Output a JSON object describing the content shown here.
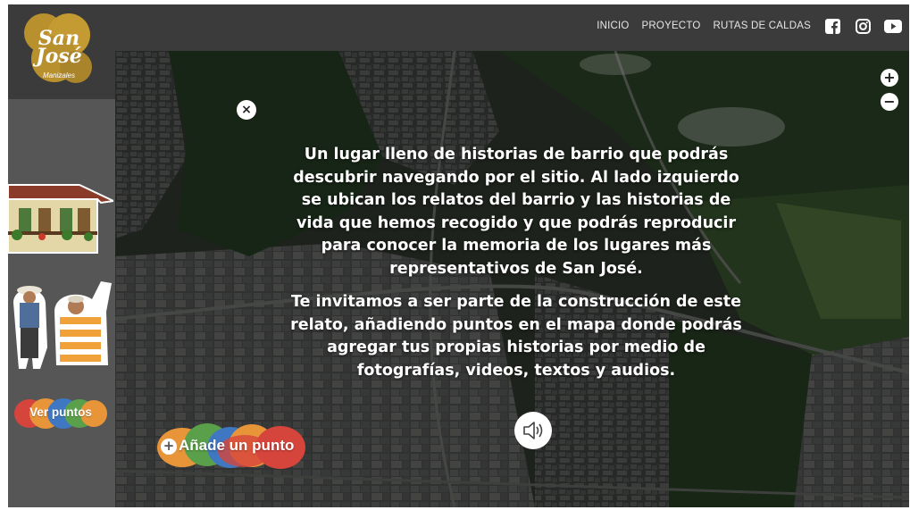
{
  "brand": {
    "title_line1": "San",
    "title_line2": "José",
    "subtitle": "Manizales",
    "color": "#b8902e"
  },
  "nav": {
    "items": [
      {
        "label": "INICIO"
      },
      {
        "label": "PROYECTO"
      },
      {
        "label": "RUTAS DE CALDAS"
      }
    ],
    "social": [
      "facebook-icon",
      "instagram-icon",
      "youtube-icon"
    ]
  },
  "sidebar": {
    "ver_puntos_label": "Ver puntos",
    "illustrations": [
      "house-illustration",
      "elders-illustration"
    ]
  },
  "intro": {
    "paragraph1": "Un lugar lleno de historias de barrio que podrás descubrir navegando por el sitio. Al lado izquierdo se ubican los relatos del barrio y las historias de vida que hemos recogido y que podrás reproducir para conocer la memoria de los lugares más representativos de San José.",
    "paragraph2": "Te invitamos a ser parte de la construcción de este relato, añadiendo puntos en el mapa donde podrás agregar tus propias historias por medio de fotografías, videos, textos y audios."
  },
  "map": {
    "close_symbol": "×",
    "zoom_in_symbol": "+",
    "zoom_out_symbol": "−",
    "add_point_label": "Añade un punto",
    "add_point_symbol": "+"
  },
  "colors": {
    "red": "#d6453c",
    "orange": "#e8953a",
    "green": "#5aa04a",
    "blue": "#3f77c2",
    "gold": "#b8902e"
  }
}
